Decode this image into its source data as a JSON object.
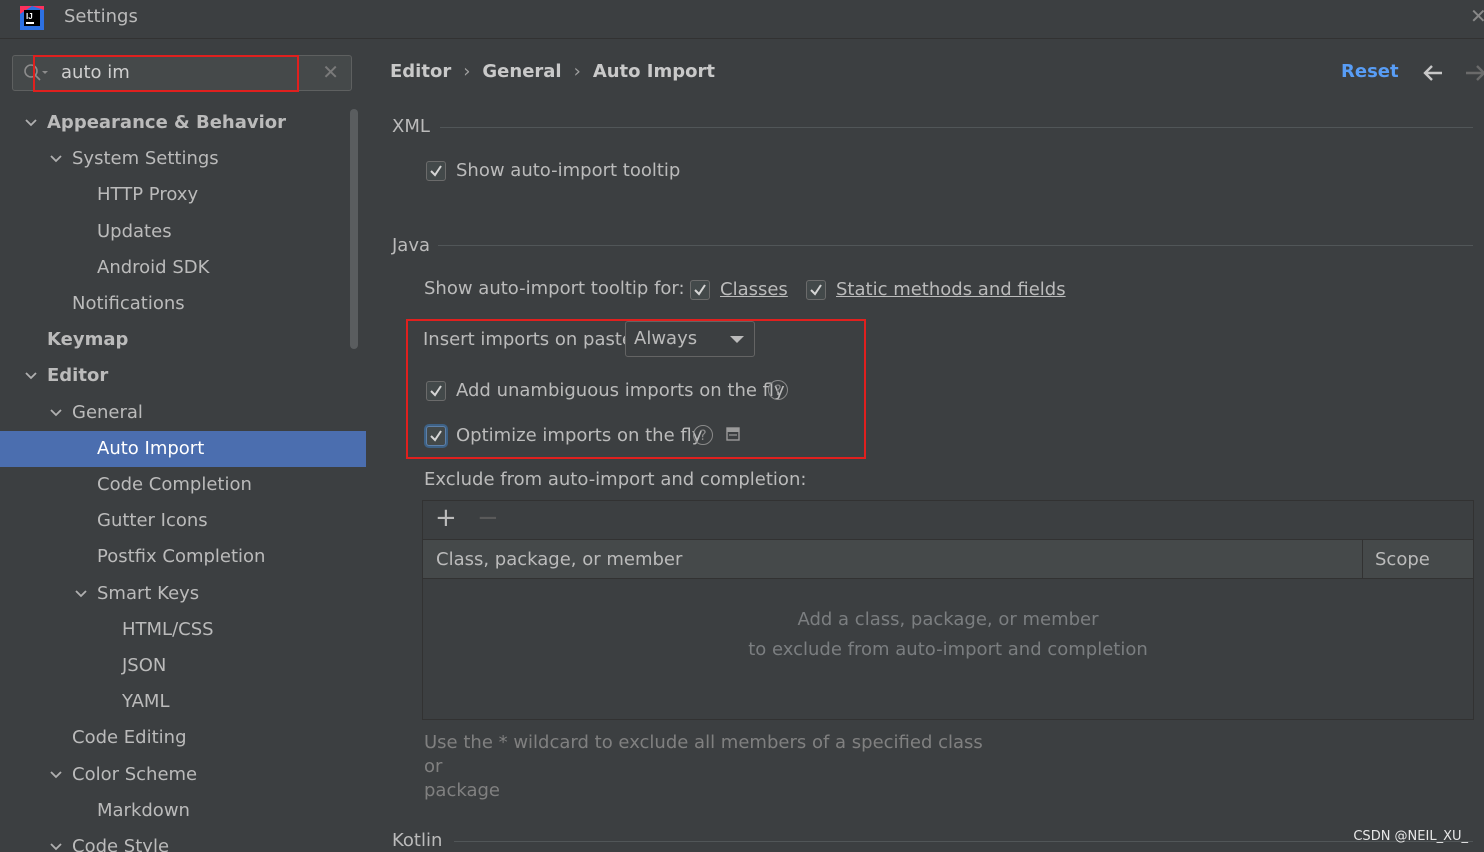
{
  "window": {
    "title": "Settings",
    "close_glyph": "✕"
  },
  "search": {
    "value": "auto im",
    "clear_glyph": "✕"
  },
  "tree": [
    {
      "label": "Appearance & Behavior",
      "bold": true,
      "expanded": true
    },
    {
      "label": "System Settings",
      "expanded": true
    },
    {
      "label": "HTTP Proxy"
    },
    {
      "label": "Updates"
    },
    {
      "label": "Android SDK"
    },
    {
      "label": "Notifications"
    },
    {
      "label": "Keymap",
      "bold": true
    },
    {
      "label": "Editor",
      "bold": true,
      "expanded": true
    },
    {
      "label": "General",
      "expanded": true
    },
    {
      "label": "Auto Import",
      "selected": true
    },
    {
      "label": "Code Completion"
    },
    {
      "label": "Gutter Icons"
    },
    {
      "label": "Postfix Completion"
    },
    {
      "label": "Smart Keys",
      "expanded": true
    },
    {
      "label": "HTML/CSS"
    },
    {
      "label": "JSON"
    },
    {
      "label": "YAML"
    },
    {
      "label": "Code Editing"
    },
    {
      "label": "Color Scheme",
      "expanded": true
    },
    {
      "label": "Markdown"
    },
    {
      "label": "Code Style",
      "expanded": true
    }
  ],
  "breadcrumb": {
    "items": [
      "Editor",
      "General",
      "Auto Import"
    ],
    "separator": "›"
  },
  "header": {
    "reset_label": "Reset"
  },
  "xml": {
    "title": "XML",
    "show_tooltip": {
      "label": "Show auto-import tooltip",
      "checked": true
    }
  },
  "java": {
    "title": "Java",
    "tooltip_for_label": "Show auto-import tooltip for:",
    "classes": {
      "label": "Classes",
      "checked": true
    },
    "static": {
      "label": "Static methods and fields",
      "checked": true
    },
    "insert_on_paste": {
      "label": "Insert imports on paste:",
      "value": "Always"
    },
    "unambiguous": {
      "label": "Add unambiguous imports on the fly",
      "checked": true
    },
    "optimize": {
      "label": "Optimize imports on the fly",
      "checked": true
    },
    "help_glyph": "?",
    "exclude_label": "Exclude from auto-import and completion:",
    "table": {
      "add_glyph": "+",
      "remove_glyph": "−",
      "columns": [
        "Class, package, or member",
        "Scope"
      ],
      "empty_line1": "Add a class, package, or member",
      "empty_line2": "to exclude from auto-import and completion"
    },
    "hint_line1": "Use the * wildcard to exclude all members of a specified class or",
    "hint_line2": "package"
  },
  "kotlin": {
    "title": "Kotlin"
  },
  "watermark": "CSDN @NEIL_XU_",
  "colors": {
    "accent": "#589df6",
    "selection": "#4b6eaf",
    "highlight": "#e0201e"
  }
}
